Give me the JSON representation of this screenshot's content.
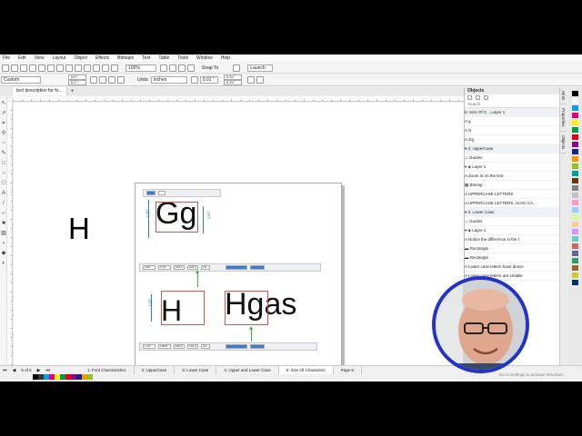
{
  "menu": [
    "File",
    "Edit",
    "View",
    "Layout",
    "Object",
    "Effects",
    "Bitmaps",
    "Text",
    "Table",
    "Tools",
    "Window",
    "Help"
  ],
  "toolbar1": {
    "zoom": "100%",
    "snap_label": "Snap To",
    "launch_label": "Launch"
  },
  "toolbar2": {
    "preset": "Custom",
    "width": "6.0 \"",
    "height": "6.0 \"",
    "units_label": "Units:",
    "units": "inches",
    "nudge": "0.01 \"",
    "dup_x": "0.25 \"",
    "dup_y": "0.25 \""
  },
  "doc_tab": "text description for fo...",
  "canvas": {
    "big_letter": "H",
    "gg": "Gg",
    "h": "H",
    "hgas": "Hgas",
    "dim_left": "1.00\"",
    "dim_right": "0.00\"",
    "dim_h": "1.00\"",
    "strip1_val": "0.0",
    "strip2_a": "0.96\"",
    "strip2_b": "0.76\"",
    "strip2_c": "100.0",
    "strip2_d": "100.0",
    "strip2_e": "0.0",
    "strip3_a": "1.15\"",
    "strip3_b": "0.800\"",
    "strip3_c": "100.0",
    "strip3_d": "100.0",
    "strip3_e": "0.0"
  },
  "page_tabs": [
    "1: Font Charcteristics",
    "2: UpperCase",
    "3: Lower Case",
    "4: Upper and Lower Case",
    "5: Size Of Characters",
    "Page 6"
  ],
  "page_counter": "5 of 6",
  "objects": {
    "title": "Objects",
    "search": "Search",
    "items": [
      {
        "label": "5: Size Of C...    Layer 1",
        "kind": "hdr"
      },
      {
        "label": "A  g",
        "kind": ""
      },
      {
        "label": "A  G",
        "kind": ""
      },
      {
        "label": "A  Gg",
        "kind": ""
      },
      {
        "label": "▾ 2: UpperCase",
        "kind": "hdr"
      },
      {
        "label": "   ⊥ Guides",
        "kind": ""
      },
      {
        "label": "  ▾ ◈ Layer 1",
        "kind": ""
      },
      {
        "label": "     A  Zoom in on the text",
        "kind": ""
      },
      {
        "label": "     ▦ Bitmap",
        "kind": ""
      },
      {
        "label": "     A  UPPERCASE LETTERS",
        "kind": ""
      },
      {
        "label": "     A  UPPERCASE LETTERS, ALSO CA...",
        "kind": ""
      },
      {
        "label": "▾ 3: Lower Case",
        "kind": "hdr"
      },
      {
        "label": "   ⊥ Guides",
        "kind": ""
      },
      {
        "label": "  ▾ ◈ Layer 1",
        "kind": ""
      },
      {
        "label": "     A  Notice the difference in the l",
        "kind": ""
      },
      {
        "label": "     ▬ Rectangle",
        "kind": ""
      },
      {
        "label": "     ▬ Rectangle",
        "kind": ""
      },
      {
        "label": "     A  Lower case letters have desce",
        "kind": ""
      },
      {
        "label": "     A  Lower case letters are smaller",
        "kind": ""
      }
    ]
  },
  "side_tabs": [
    "Hints",
    "Properties",
    "Objects"
  ],
  "activate_caption": "Go to Settings to activate Windows.",
  "colors": {
    "accent": "#2a7fc9",
    "red": "#d9534f",
    "green": "#3cb043",
    "webcam_ring": "#2233cc"
  },
  "palette": [
    "#000000",
    "#ffffff",
    "#00a0e9",
    "#e4007f",
    "#fff100",
    "#009944",
    "#e60012",
    "#920783",
    "#1d2088",
    "#f39800",
    "#8fc31f",
    "#00a29a",
    "#603813",
    "#808080",
    "#c0c0c0",
    "#ff99cc",
    "#99ccff",
    "#ccff99",
    "#ffcc99",
    "#cc99ff",
    "#66cccc",
    "#cc6666",
    "#666699",
    "#339966",
    "#996633",
    "#cccc33",
    "#003366"
  ],
  "bottom_palette": [
    "#000000",
    "#333333",
    "#00a0e9",
    "#e4007f",
    "#fff100",
    "#009944",
    "#e60012",
    "#920783",
    "#1d2088",
    "#f39800",
    "#8fc31f"
  ]
}
